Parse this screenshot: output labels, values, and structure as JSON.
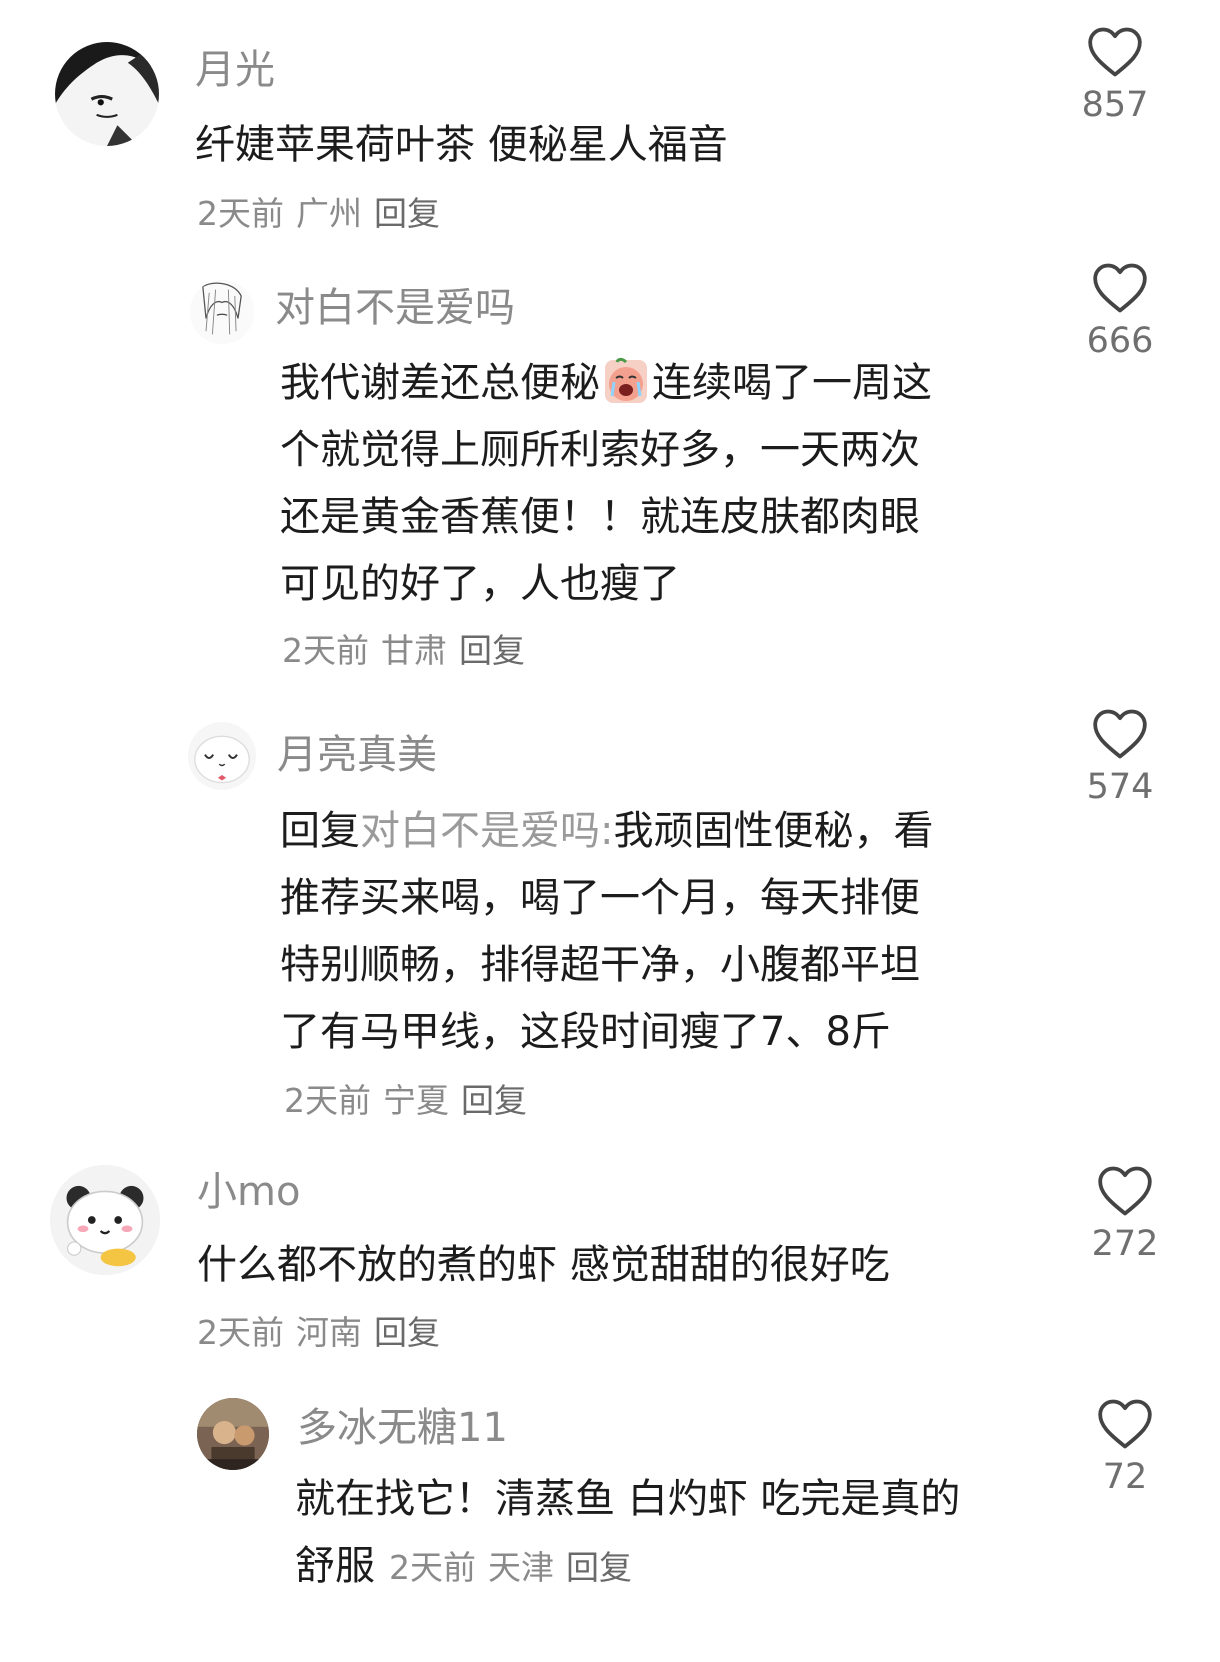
{
  "comments": [
    {
      "username": "月光",
      "lines": [
        "纤婕苹果荷叶茶 便秘星人福音"
      ],
      "time": "2天前",
      "location": "广州",
      "reply_label": "回复",
      "likes": "857"
    },
    {
      "username": "对白不是爱吗",
      "line1_before_emoji": "我代谢差还总便秘",
      "line1_after_emoji": "连续喝了一周这",
      "lines": [
        "个就觉得上厕所利索好多，一天两次",
        "还是黄金香蕉便！！就连皮肤都肉眼",
        "可见的好了，人也瘦了"
      ],
      "emoji_icon": "crying-peach-emoji-icon",
      "time": "2天前",
      "location": "甘肃",
      "reply_label": "回复",
      "likes": "666"
    },
    {
      "username": "月亮真美",
      "reply_prefix": "回复",
      "mention": "对白不是爱吗:",
      "line1_rest": "我顽固性便秘，看",
      "lines": [
        "推荐买来喝，喝了一个月，每天排便",
        "特别顺畅，排得超干净，小腹都平坦",
        "了有马甲线，这段时间瘦了7、8斤"
      ],
      "time": "2天前",
      "location": "宁夏",
      "reply_label": "回复",
      "likes": "574"
    },
    {
      "username": "小mo",
      "lines": [
        "什么都不放的煮的虾 感觉甜甜的很好吃"
      ],
      "time": "2天前",
      "location": "河南",
      "reply_label": "回复",
      "likes": "272"
    },
    {
      "username": "多冰无糖11",
      "lines": [
        "就在找它！清蒸鱼 白灼虾 吃完是真的"
      ],
      "last_line": "舒服",
      "time": "2天前",
      "location": "天津",
      "reply_label": "回复",
      "likes": "72"
    }
  ],
  "icons": {
    "like": "heart-outline-icon"
  },
  "colors": {
    "username": "#8a8a8a",
    "text": "#1c1c1c",
    "meta": "#8a8a8a",
    "mention": "#9a9a9a"
  }
}
